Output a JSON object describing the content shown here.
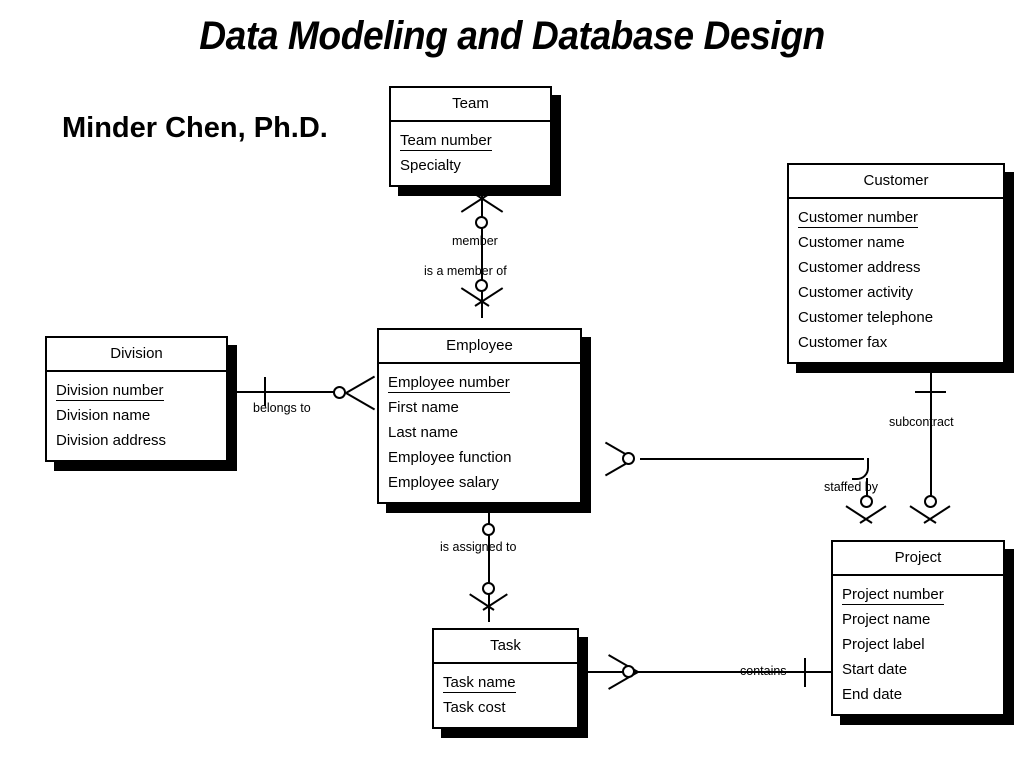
{
  "slide": {
    "title": "Data Modeling and Database Design",
    "author": "Minder Chen, Ph.D."
  },
  "entities": {
    "team": {
      "name": "Team",
      "attributes": [
        {
          "label": "Team number",
          "pk": true
        },
        {
          "label": "Specialty",
          "pk": false
        }
      ]
    },
    "customer": {
      "name": "Customer",
      "attributes": [
        {
          "label": "Customer number",
          "pk": true
        },
        {
          "label": "Customer name",
          "pk": false
        },
        {
          "label": "Customer address",
          "pk": false
        },
        {
          "label": "Customer activity",
          "pk": false
        },
        {
          "label": "Customer telephone",
          "pk": false
        },
        {
          "label": "Customer fax",
          "pk": false
        }
      ]
    },
    "division": {
      "name": "Division",
      "attributes": [
        {
          "label": "Division number",
          "pk": true
        },
        {
          "label": "Division name",
          "pk": false
        },
        {
          "label": "Division address",
          "pk": false
        }
      ]
    },
    "employee": {
      "name": "Employee",
      "attributes": [
        {
          "label": "Employee number",
          "pk": true
        },
        {
          "label": "First name",
          "pk": false
        },
        {
          "label": "Last name",
          "pk": false
        },
        {
          "label": "Employee function",
          "pk": false
        },
        {
          "label": "Employee salary",
          "pk": false
        }
      ]
    },
    "project": {
      "name": "Project",
      "attributes": [
        {
          "label": "Project number",
          "pk": true
        },
        {
          "label": "Project name",
          "pk": false
        },
        {
          "label": "Project label",
          "pk": false
        },
        {
          "label": "Start date",
          "pk": false
        },
        {
          "label": "End date",
          "pk": false
        }
      ]
    },
    "task": {
      "name": "Task",
      "attributes": [
        {
          "label": "Task name",
          "pk": true
        },
        {
          "label": "Task cost",
          "pk": false
        }
      ]
    }
  },
  "relationships": {
    "member": "member",
    "is_a_member_of": "is a member of",
    "belongs_to": "belongs to",
    "subcontract": "subcontract",
    "staffed_by": "staffed by",
    "is_assigned_to": "is assigned to",
    "contains": "contains"
  },
  "colors": {
    "ink": "#000000",
    "paper": "#ffffff"
  }
}
